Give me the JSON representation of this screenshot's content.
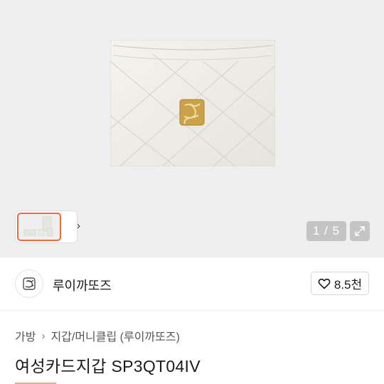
{
  "gallery": {
    "counter_current": "1",
    "counter_sep": "/",
    "counter_total": "5",
    "expand_icon": "expand-icon",
    "thumb_next_icon": "chevron-right-icon",
    "background_color": "#efefef",
    "thumb_active_border_color": "#f06a3d"
  },
  "shop": {
    "name": "루이까또즈",
    "avatar_icon": "shop-logo-icon",
    "like_icon": "heart-outline-icon",
    "like_count": "8.5천"
  },
  "breadcrumb": {
    "items": [
      "가방",
      "지갑/머니클립 (루이까또즈)"
    ],
    "separator": "›"
  },
  "product": {
    "title": "여성카드지갑 SP3QT04IV"
  },
  "colors": {
    "accent": "#f5a48a"
  }
}
